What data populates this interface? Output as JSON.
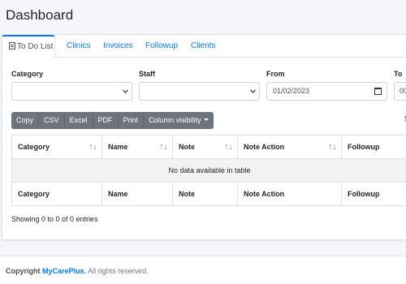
{
  "header": {
    "title": "Dashboard"
  },
  "tabs": [
    {
      "label": "To Do List",
      "icon": "clipboard-icon",
      "active": true
    },
    {
      "label": "Clinics"
    },
    {
      "label": "Invoices"
    },
    {
      "label": "Followup"
    },
    {
      "label": "Clients"
    }
  ],
  "filters": {
    "category": {
      "label": "Category",
      "value": ""
    },
    "staff": {
      "label": "Staff",
      "value": ""
    },
    "from": {
      "label": "From",
      "value": "01/02/2023"
    },
    "to": {
      "label": "To",
      "value": "00"
    }
  },
  "buttons": [
    "Copy",
    "CSV",
    "Excel",
    "PDF",
    "Print",
    "Column visibility"
  ],
  "search_fragment": "S",
  "table": {
    "columns": [
      "Category",
      "Name",
      "Note",
      "Note Action",
      "Followup"
    ],
    "empty_message": "No data available in table",
    "info": "Showing 0 to 0 of 0 entries"
  },
  "footer": {
    "prefix": "Copyright",
    "brand": "MyCarePlus.",
    "suffix": "All rights reserved."
  },
  "colors": {
    "accent": "#007bff",
    "button_bg": "#6c757d",
    "page_bg": "#f4f6f9"
  }
}
